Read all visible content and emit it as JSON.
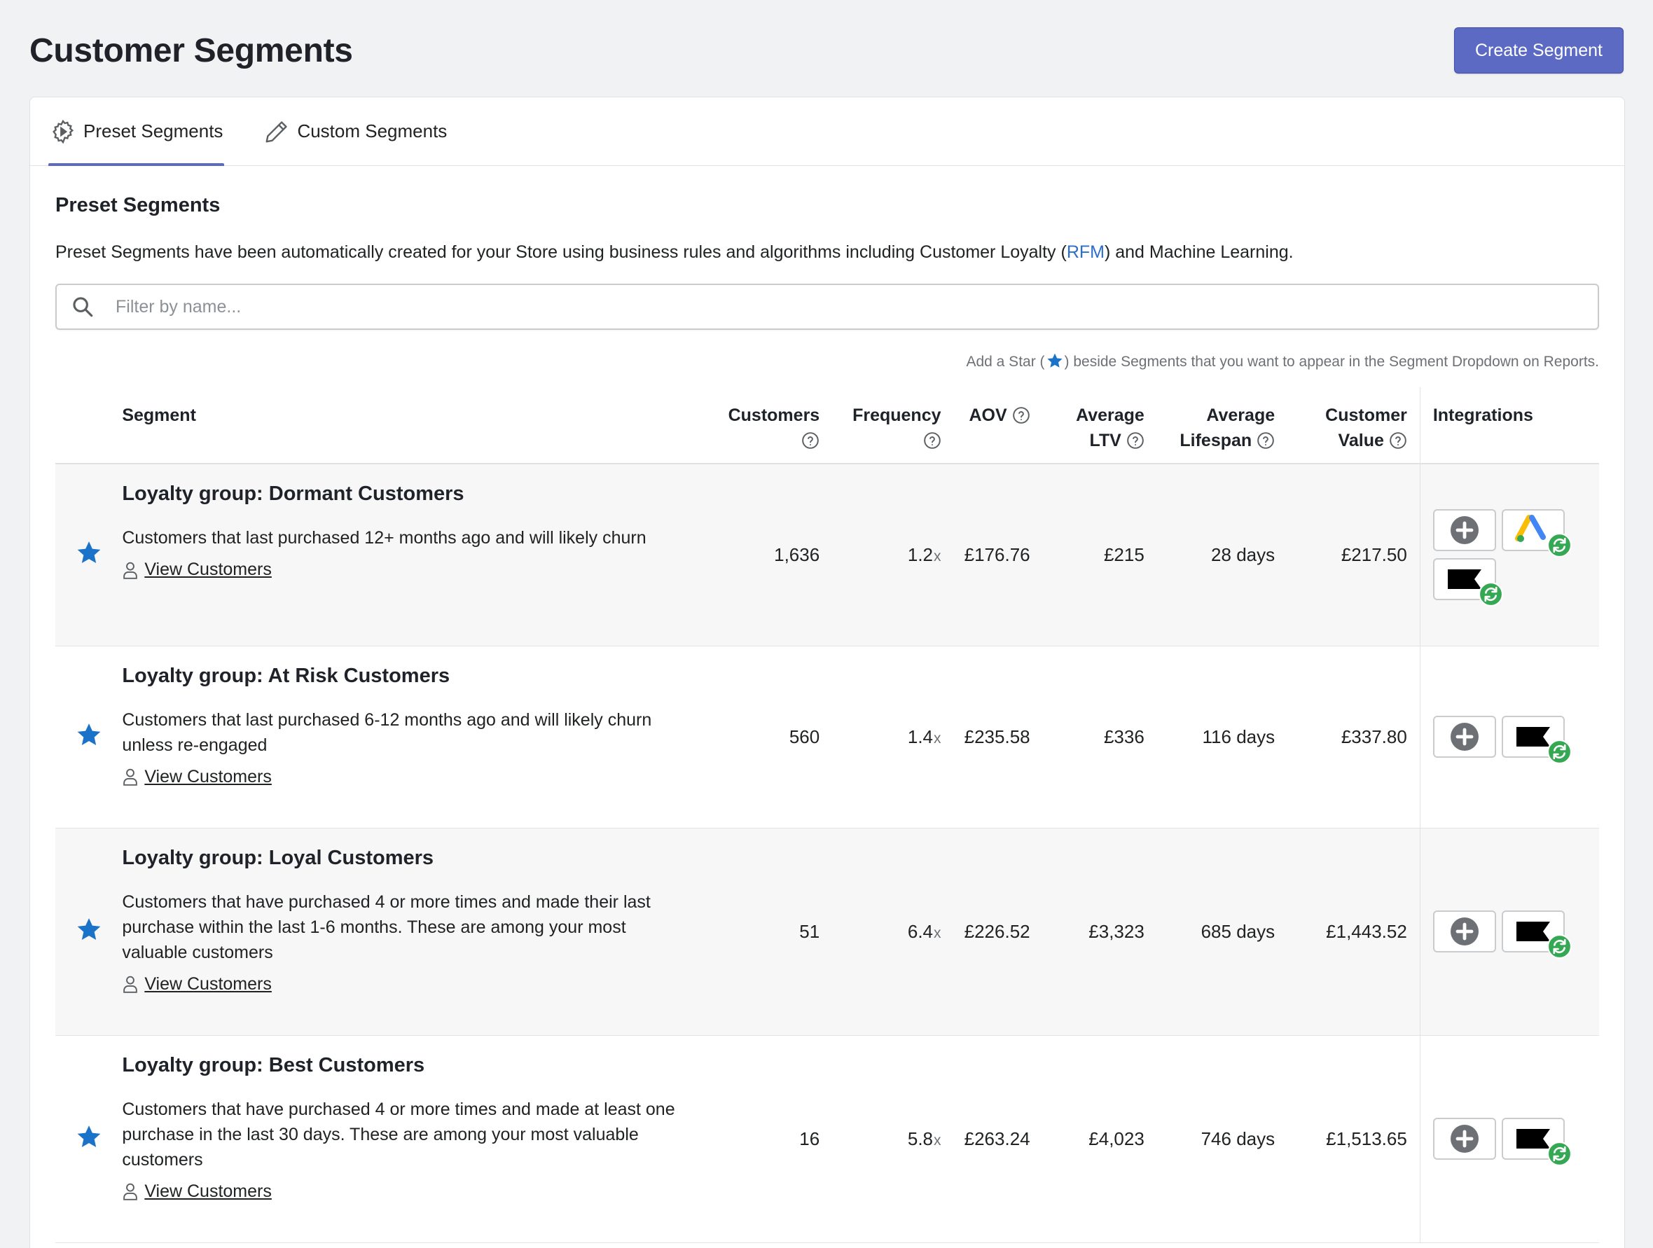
{
  "page": {
    "title": "Customer Segments",
    "create_button": "Create Segment"
  },
  "tabs": [
    {
      "label": "Preset Segments",
      "icon": "gear-icon",
      "active": true
    },
    {
      "label": "Custom Segments",
      "icon": "pencil-icon",
      "active": false
    }
  ],
  "section": {
    "title": "Preset Segments",
    "desc_before": "Preset Segments have been automatically created for your Store using business rules and algorithms including Customer Loyalty (",
    "desc_link": "RFM",
    "desc_after": ") and Machine Learning."
  },
  "search": {
    "placeholder": "Filter by name..."
  },
  "star_hint": {
    "before": "Add a Star (",
    "after": ") beside Segments that you want to appear in the Segment Dropdown on Reports."
  },
  "table": {
    "headers": {
      "segment": "Segment",
      "customers": "Customers",
      "frequency": "Frequency",
      "aov": "AOV",
      "ltv_1": "Average",
      "ltv_2": "LTV",
      "lifespan_1": "Average",
      "lifespan_2": "Lifespan",
      "value_1": "Customer",
      "value_2": "Value",
      "integrations": "Integrations"
    },
    "view_label": "View Customers",
    "freq_suffix": "x",
    "rows": [
      {
        "name": "Loyalty group: Dormant Customers",
        "desc": "Customers that last purchased 12+ months ago and will likely churn",
        "customers": "1,636",
        "frequency": "1.2",
        "aov": "£176.76",
        "ltv": "£215",
        "lifespan": "28 days",
        "value": "£217.50",
        "integrations": [
          "add-icon",
          "google-ads-logo-icon",
          "klaviyo-flag-icon"
        ]
      },
      {
        "name": "Loyalty group: At Risk Customers",
        "desc": "Customers that last purchased 6-12 months ago and will likely churn unless re-engaged",
        "customers": "560",
        "frequency": "1.4",
        "aov": "£235.58",
        "ltv": "£336",
        "lifespan": "116 days",
        "value": "£337.80",
        "integrations": [
          "add-icon",
          "klaviyo-flag-icon"
        ]
      },
      {
        "name": "Loyalty group: Loyal Customers",
        "desc": "Customers that have purchased 4 or more times and made their last purchase within the last 1-6 months. These are among your most valuable customers",
        "customers": "51",
        "frequency": "6.4",
        "aov": "£226.52",
        "ltv": "£3,323",
        "lifespan": "685 days",
        "value": "£1,443.52",
        "integrations": [
          "add-icon",
          "klaviyo-flag-icon"
        ]
      },
      {
        "name": "Loyalty group: Best Customers",
        "desc": "Customers that have purchased 4 or more times and made at least one purchase in the last 30 days. These are among your most valuable customers",
        "customers": "16",
        "frequency": "5.8",
        "aov": "£263.24",
        "ltv": "£4,023",
        "lifespan": "746 days",
        "value": "£1,513.65",
        "integrations": [
          "add-icon",
          "klaviyo-flag-icon"
        ]
      }
    ]
  },
  "colors": {
    "accent": "#5c6ac4",
    "star": "#1a73c8",
    "link": "#2c6ecb",
    "sync_badge": "#35a853"
  }
}
